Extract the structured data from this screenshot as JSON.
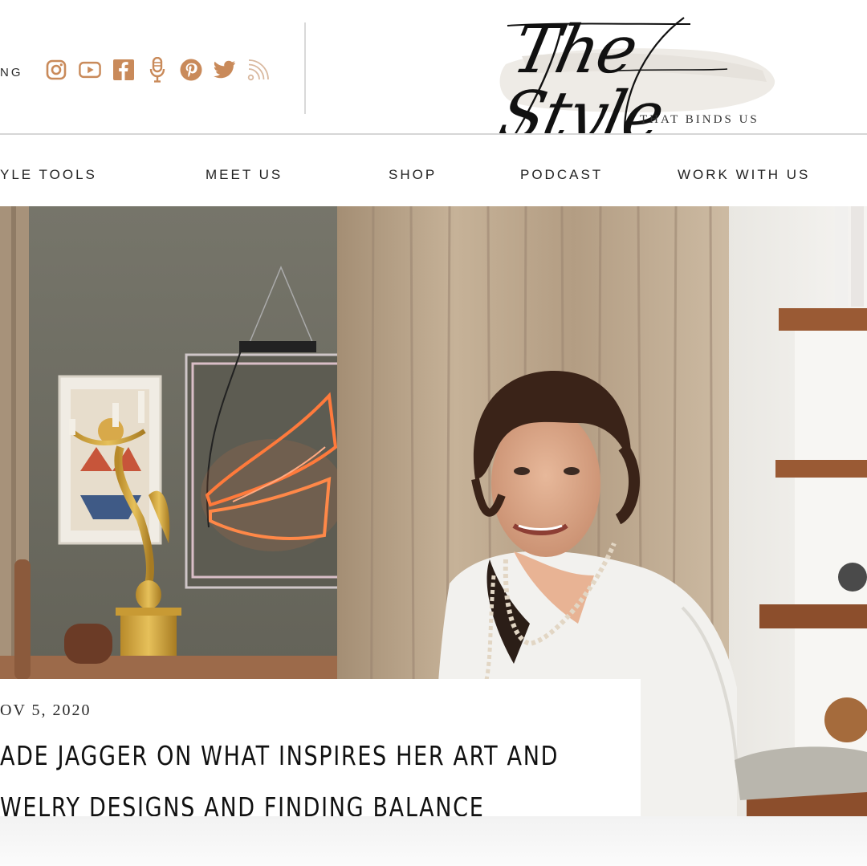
{
  "header": {
    "link_label": "NG",
    "social_icons": [
      "instagram-icon",
      "youtube-icon",
      "facebook-icon",
      "microphone-icon",
      "pinterest-icon",
      "twitter-icon",
      "rss-icon"
    ],
    "icon_color": "#c98a5a"
  },
  "logo": {
    "script_text": "The Style",
    "tagline": "THAT BINDS US"
  },
  "nav": {
    "items": [
      {
        "label": "YLE TOOLS"
      },
      {
        "label": "MEET US"
      },
      {
        "label": "SHOP"
      },
      {
        "label": "PODCAST"
      },
      {
        "label": "WORK WITH US"
      }
    ]
  },
  "article": {
    "date": "OV 5, 2020",
    "title_line1": "ADE JAGGER ON WHAT INSPIRES HER ART AND",
    "title_line2": "WELRY DESIGNS AND FINDING BALANCE"
  },
  "colors": {
    "accent": "#c98a5a",
    "text": "#111111",
    "wall": "#6f6e63",
    "curtain": "#b9a58c"
  }
}
